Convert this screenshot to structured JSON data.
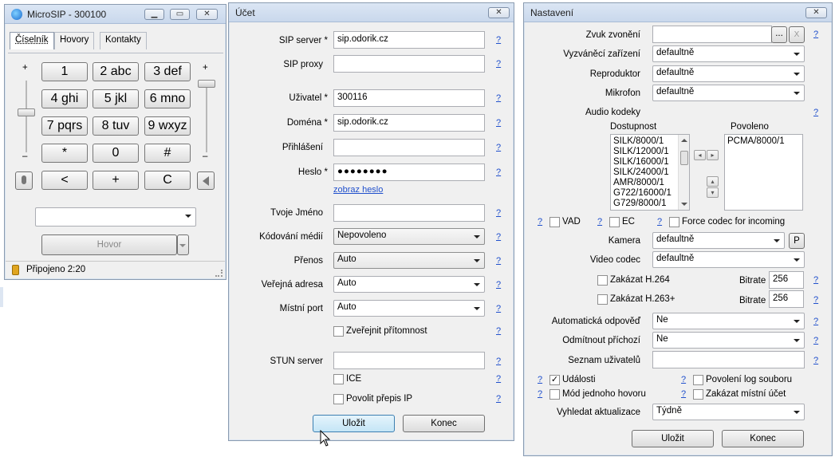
{
  "microsip": {
    "title": "MicroSIP - 300100",
    "tabs": [
      "Číselník",
      "Hovory",
      "Kontakty"
    ],
    "keys": [
      "1",
      "2 abc",
      "3 def",
      "4 ghi",
      "5 jkl",
      "6 mno",
      "7 pqrs",
      "8 tuv",
      "9 wxyz",
      "*",
      "0",
      "#",
      "<",
      "+",
      "C"
    ],
    "plus_left": "+",
    "minus_left": "–",
    "plus_right": "+",
    "minus_right": "–",
    "call_button": "Hovor",
    "status": "Připojeno 2:20"
  },
  "ucet": {
    "title": "Účet",
    "fields": [
      {
        "label": "SIP server",
        "req": "*",
        "value": ""
      },
      {
        "label": "SIP proxy",
        "req": "",
        "value": ""
      },
      {
        "label": "Uživatel",
        "req": "*",
        "value": "300116"
      },
      {
        "label": "Doména",
        "req": "*",
        "value": "sip.odorik.cz"
      },
      {
        "label": "Přihlášení",
        "req": "",
        "value": ""
      },
      {
        "label": "Heslo",
        "req": "*",
        "value": "●●●●●●●●"
      },
      {
        "label": "Tvoje Jméno",
        "req": "",
        "value": ""
      }
    ],
    "sip_server_value": "sip.odorik.cz",
    "show_password": "zobraz heslo",
    "selects": [
      {
        "label": "Kódování médií",
        "value": "Nepovoleno"
      },
      {
        "label": "Přenos",
        "value": "Auto"
      },
      {
        "label": "Veřejná adresa",
        "value": "Auto"
      },
      {
        "label": "Místní port",
        "value": "Auto"
      }
    ],
    "publish_presence": "Zveřejnit přítomnost",
    "stun_label": "STUN server",
    "ice": "ICE",
    "allow_ip_rewrite": "Povolit přepis IP",
    "save": "Uložit",
    "end": "Konec",
    "help": "?"
  },
  "nastaveni": {
    "title": "Nastavení",
    "ring_sound": "Zvuk zvonění",
    "browse": "...",
    "clear": "X",
    "ring_device": {
      "label": "Vyzváněcí zařízení",
      "value": "defaultně"
    },
    "speaker": {
      "label": "Reproduktor",
      "value": "defaultně"
    },
    "mic": {
      "label": "Mikrofon",
      "value": "defaultně"
    },
    "audio_codecs": "Audio kodeky",
    "available": "Dostupnost",
    "allowed": "Povoleno",
    "available_list": [
      "SILK/8000/1",
      "SILK/12000/1",
      "SILK/16000/1",
      "SILK/24000/1",
      "AMR/8000/1",
      "G722/16000/1",
      "G729/8000/1"
    ],
    "allowed_list": [
      "PCMA/8000/1"
    ],
    "vad": "VAD",
    "ec": "EC",
    "force_codec": "Force codec for incoming",
    "camera": {
      "label": "Kamera",
      "value": "defaultně"
    },
    "camera_p": "P",
    "video_codec": {
      "label": "Video codec",
      "value": "defaultně"
    },
    "disable_h264": "Zakázat H.264",
    "disable_h263": "Zakázat H.263+",
    "bitrate_label": "Bitrate",
    "bitrate1": "256",
    "bitrate2": "256",
    "auto_answer": {
      "label": "Automatická odpověď",
      "value": "Ne"
    },
    "reject_incoming": {
      "label": "Odmítnout příchozí",
      "value": "Ne"
    },
    "user_list": "Seznam uživatelů",
    "events": "Události",
    "log_file": "Povolení log souboru",
    "single_call": "Mód jednoho hovoru",
    "disable_local": "Zakázat místní účet",
    "check_updates": {
      "label": "Vyhledat aktualizace",
      "value": "Týdně"
    },
    "save": "Uložit",
    "end": "Konec"
  }
}
